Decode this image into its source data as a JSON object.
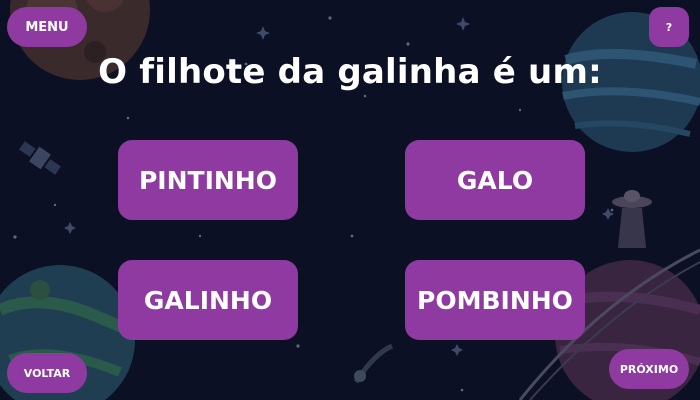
{
  "header": {
    "menu_label": "MENU",
    "help_label": "?"
  },
  "question": {
    "text": "O filhote da galinha é um:"
  },
  "answers": [
    {
      "label": "PINTINHO"
    },
    {
      "label": "GALO"
    },
    {
      "label": "GALINHO"
    },
    {
      "label": "POMBINHO"
    }
  ],
  "footer": {
    "back_label": "VOLTAR",
    "next_label": "PRÓXIMO"
  },
  "colors": {
    "background": "#0c1024",
    "button": "#8e3aa0",
    "text": "#ffffff"
  }
}
